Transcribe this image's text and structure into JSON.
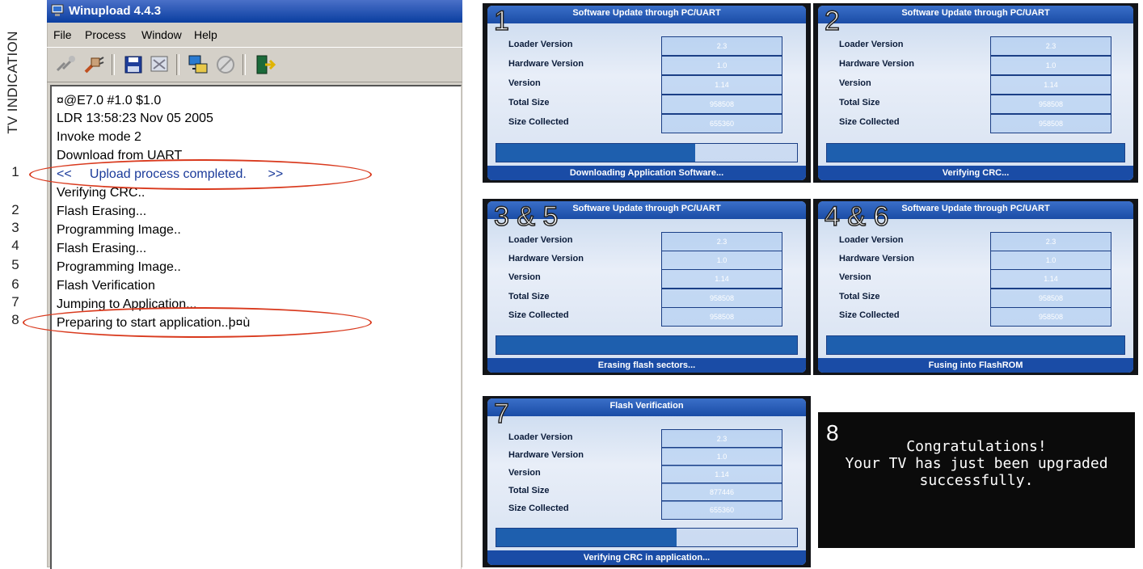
{
  "side_label": "TV INDICATION",
  "step_numbers": [
    "1",
    "2",
    "3",
    "4",
    "5",
    "6",
    "7",
    "8"
  ],
  "window": {
    "title": "Winupload 4.4.3",
    "menu": [
      "File",
      "Process",
      "Window",
      "Help"
    ],
    "toolbar_icons": [
      "disconnect-icon",
      "connect-plug-icon",
      "save-disk-icon",
      "screen-icon",
      "transfer-icon",
      "stop-icon",
      "exit-door-icon"
    ]
  },
  "console_lines": [
    "¤@E7.0  #1.0 $1.0",
    "LDR 13:58:23 Nov 05 2005",
    "Invoke mode 2",
    "Download from UART",
    "<<     Upload process completed.      >>",
    "Verifying CRC..",
    "Flash Erasing...",
    "Programming Image..",
    "Flash Erasing...",
    "Programming Image..",
    "Flash Verification",
    "Jumping to Application...",
    "Preparing to start application..þ¤ù"
  ],
  "tv_screens": [
    {
      "number": "1",
      "header": "Software Update through PC/UART",
      "footer": "Downloading Application Software...",
      "fields": [
        {
          "label": "Loader Version",
          "value": "2.3"
        },
        {
          "label": "Hardware Version",
          "value": "1.0"
        },
        {
          "label": "Version",
          "value": "1.14"
        },
        {
          "label": "Total Size",
          "value": "958508"
        },
        {
          "label": "Size Collected",
          "value": "655360"
        }
      ],
      "progress": 0.66
    },
    {
      "number": "2",
      "header": "Software Update through PC/UART",
      "footer": "Verifying CRC...",
      "fields": [
        {
          "label": "Loader Version",
          "value": "2.3"
        },
        {
          "label": "Hardware Version",
          "value": "1.0"
        },
        {
          "label": "Version",
          "value": "1.14"
        },
        {
          "label": "Total Size",
          "value": "958508"
        },
        {
          "label": "Size Collected",
          "value": "958508"
        }
      ],
      "progress": 1.0
    },
    {
      "number": "3 & 5",
      "header": "Software Update through PC/UART",
      "footer": "Erasing flash sectors...",
      "fields": [
        {
          "label": "Loader Version",
          "value": "2.3"
        },
        {
          "label": "Hardware Version",
          "value": "1.0"
        },
        {
          "label": "Version",
          "value": "1.14"
        },
        {
          "label": "Total Size",
          "value": "958508"
        },
        {
          "label": "Size Collected",
          "value": "958508"
        }
      ],
      "progress": 1.0
    },
    {
      "number": "4 & 6",
      "header": "Software Update through PC/UART",
      "footer": "Fusing into FlashROM",
      "fields": [
        {
          "label": "Loader Version",
          "value": "2.3"
        },
        {
          "label": "Hardware Version",
          "value": "1.0"
        },
        {
          "label": "Version",
          "value": "1.14"
        },
        {
          "label": "Total Size",
          "value": "958508"
        },
        {
          "label": "Size Collected",
          "value": "958508"
        }
      ],
      "progress": 1.0
    },
    {
      "number": "7",
      "header": "Flash Verification",
      "footer": "Verifying CRC in application...",
      "fields": [
        {
          "label": "Loader Version",
          "value": "2.3"
        },
        {
          "label": "Hardware Version",
          "value": "1.0"
        },
        {
          "label": "Version",
          "value": "1.14"
        },
        {
          "label": "Total Size",
          "value": "877446"
        },
        {
          "label": "Size Collected",
          "value": "655360"
        }
      ],
      "progress": 0.6
    }
  ],
  "tv8": {
    "number": "8",
    "lines": [
      "Congratulations!",
      "Your TV has just been upgraded",
      "successfully."
    ]
  }
}
